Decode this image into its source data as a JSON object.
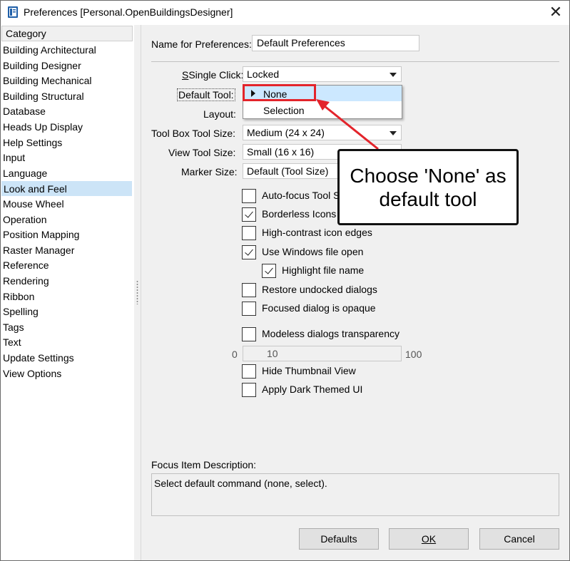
{
  "window": {
    "title": "Preferences [Personal.OpenBuildingsDesigner]",
    "close_glyph": "✕",
    "app_icon": "book-icon"
  },
  "sidebar": {
    "header": "Category",
    "selected_index": 9,
    "items": [
      {
        "label": "Building Architectural"
      },
      {
        "label": "Building Designer"
      },
      {
        "label": "Building Mechanical"
      },
      {
        "label": "Building Structural"
      },
      {
        "label": "Database"
      },
      {
        "label": "Heads Up Display"
      },
      {
        "label": "Help Settings"
      },
      {
        "label": "Input"
      },
      {
        "label": "Language"
      },
      {
        "label": "Look and Feel"
      },
      {
        "label": "Mouse Wheel"
      },
      {
        "label": "Operation"
      },
      {
        "label": "Position Mapping"
      },
      {
        "label": "Raster Manager"
      },
      {
        "label": "Reference"
      },
      {
        "label": "Rendering"
      },
      {
        "label": "Ribbon"
      },
      {
        "label": "Spelling"
      },
      {
        "label": "Tags"
      },
      {
        "label": "Text"
      },
      {
        "label": "Update Settings"
      },
      {
        "label": "View Options"
      }
    ]
  },
  "form": {
    "name_label": "Name for Preferences:",
    "name_value": "Default Preferences",
    "single_click_label": "Single Click:",
    "single_click_value": "Locked",
    "default_tool_label": "Default Tool:",
    "layout_label": "Layout:",
    "toolbox_size_label": "Tool Box Tool Size:",
    "toolbox_size_value": "Medium (24 x 24)",
    "view_tool_size_label": "View Tool Size:",
    "view_tool_size_value": "Small (16 x 16)",
    "marker_size_label": "Marker Size:",
    "marker_size_value": "Default (Tool Size)",
    "checkboxes": [
      {
        "label": "Auto-focus Tool S",
        "checked": false
      },
      {
        "label": "Borderless Icons",
        "checked": true
      },
      {
        "label": "High-contrast icon edges",
        "checked": false
      },
      {
        "label": "Use Windows file open",
        "checked": true
      },
      {
        "label": "Highlight file name",
        "checked": true
      },
      {
        "label": "Restore undocked dialogs",
        "checked": false
      },
      {
        "label": "Focused dialog is opaque",
        "checked": false
      },
      {
        "label": "Modeless dialogs transparency",
        "checked": false
      },
      {
        "label": "Hide Thumbnail View",
        "checked": false
      },
      {
        "label": "Apply Dark Themed UI",
        "checked": false
      }
    ],
    "transparency_min": "0",
    "transparency_value": "10",
    "transparency_max": "100"
  },
  "dropdown": {
    "options": [
      "None",
      "Selection"
    ],
    "highlighted": "None"
  },
  "focus": {
    "label": "Focus Item Description:",
    "text": "Select default command (none, select)."
  },
  "buttons": {
    "defaults": "Defaults",
    "ok": "OK",
    "cancel": "Cancel"
  },
  "annotation": {
    "callout_text": "Choose 'None' as default tool",
    "accent_color": "#e3242b"
  },
  "colors": {
    "selection": "#cce4f7",
    "dropdown_highlight": "#cce8ff",
    "dialog_bg": "#f0f0f0"
  }
}
